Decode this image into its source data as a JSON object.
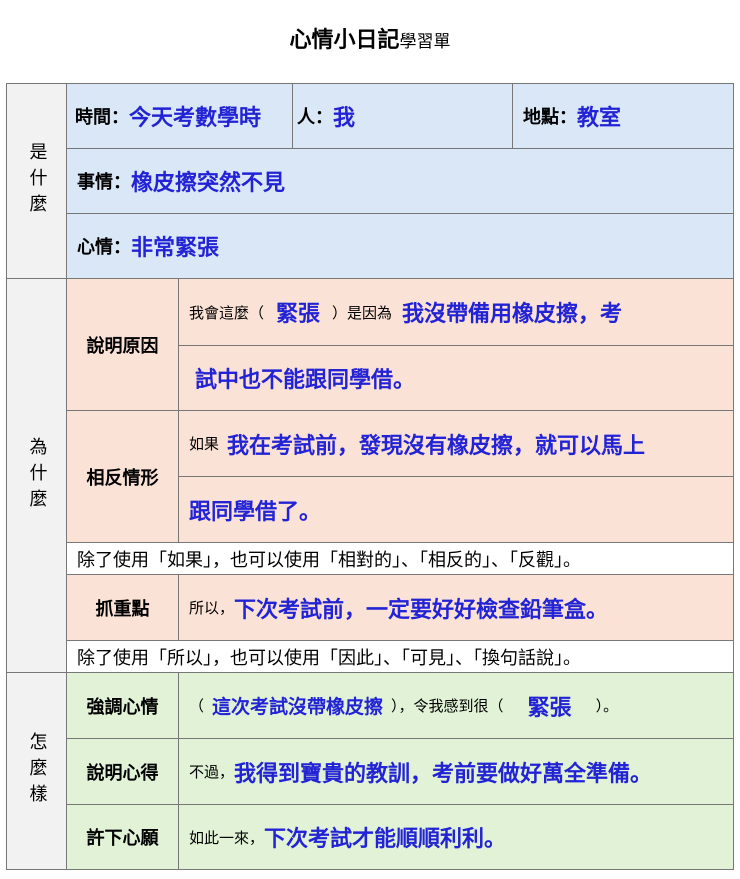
{
  "title": {
    "main": "心情小日記",
    "sub": "學習單"
  },
  "sections": {
    "what": "是什麼",
    "why": "為什麼",
    "how": "怎麼樣"
  },
  "what": {
    "time_label": "時間：",
    "time": "今天考數學時",
    "person_label": "人：",
    "person": "我",
    "place_label": "地點：",
    "place": "教室",
    "event_label": "事情：",
    "event": "橡皮擦突然不見",
    "mood_label": "心情：",
    "mood": "非常緊張"
  },
  "why": {
    "reason_label": "說明原因",
    "reason_prefix": "我會這麼（",
    "reason_mood": "緊張",
    "reason_mid": "）是因為",
    "reason_line1": "我沒帶備用橡皮擦，考",
    "reason_line2": "試中也不能跟同學借。",
    "contrary_label": "相反情形",
    "contrary_prefix": "如果",
    "contrary_line1": "我在考試前，發現沒有橡皮擦，就可以馬上",
    "contrary_line2": "跟同學借了。",
    "note1": "除了使用「如果」，也可以使用「相對的」、「相反的」、「反觀」。",
    "key_label": "抓重點",
    "key_prefix": "所以，",
    "key_text": "下次考試前，一定要好好檢查鉛筆盒。",
    "note2": "除了使用「所以」，也可以使用「因此」、「可見」、「換句話說」。"
  },
  "how": {
    "emph_label": "強調心情",
    "emph_open": "（",
    "emph_text": "這次考試沒帶橡皮擦",
    "emph_mid": "），令我感到很（",
    "emph_mood": "緊張",
    "emph_close": "）。",
    "lesson_label": "說明心得",
    "lesson_prefix": "不過，",
    "lesson_text": "我得到寶貴的教訓，考前要做好萬全準備。",
    "wish_label": "許下心願",
    "wish_prefix": "如此一來，",
    "wish_text": "下次考試才能順順利利。"
  }
}
